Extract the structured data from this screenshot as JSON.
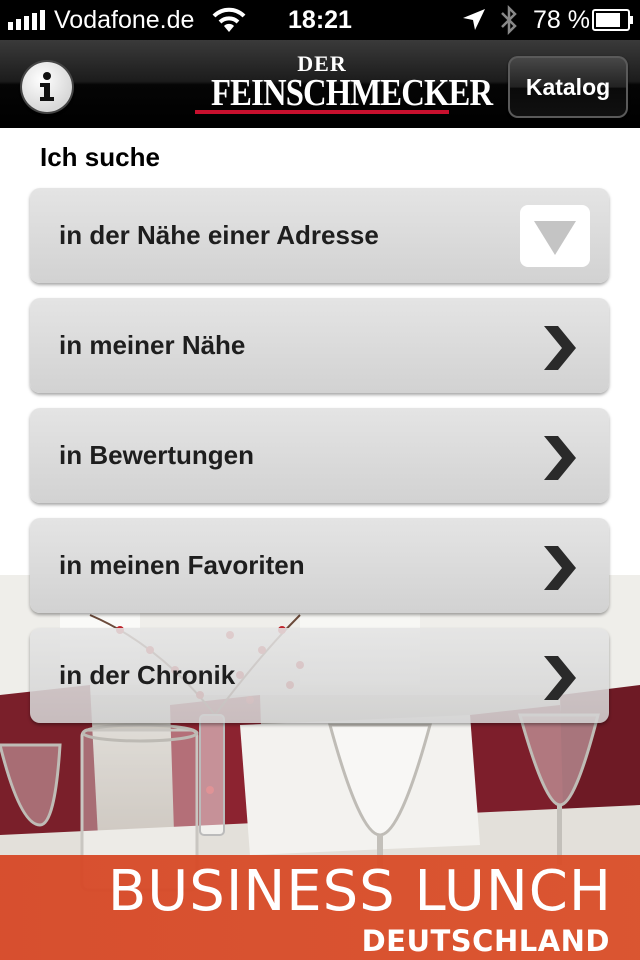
{
  "status_bar": {
    "carrier": "Vodafone.de",
    "time": "18:21",
    "battery": "78 %",
    "icons": [
      "signal-icon",
      "wifi-icon",
      "location-icon",
      "bluetooth-icon",
      "battery-icon"
    ]
  },
  "nav_bar": {
    "logo_top": "DER",
    "logo_main": "FEINSCHMECKER",
    "info_icon": "info-icon",
    "katalog_label": "Katalog"
  },
  "search": {
    "heading": "Ich suche",
    "items": [
      {
        "label": "in der Nähe einer Adresse",
        "icon": "dropdown-arrow-icon"
      },
      {
        "label": "in meiner Nähe",
        "icon": "chevron-right-icon"
      },
      {
        "label": "in Bewertungen",
        "icon": "chevron-right-icon"
      },
      {
        "label": "in meinen Favoriten",
        "icon": "chevron-right-icon"
      },
      {
        "label": "in der Chronik",
        "icon": "chevron-right-icon"
      }
    ]
  },
  "banner": {
    "title": "BUSINESS LUNCH",
    "subtitle": "DEUTSCHLAND"
  },
  "colors": {
    "banner": "#d8482a",
    "logo_underline": "#c8102e",
    "menu_item": "#d9d9d9"
  }
}
